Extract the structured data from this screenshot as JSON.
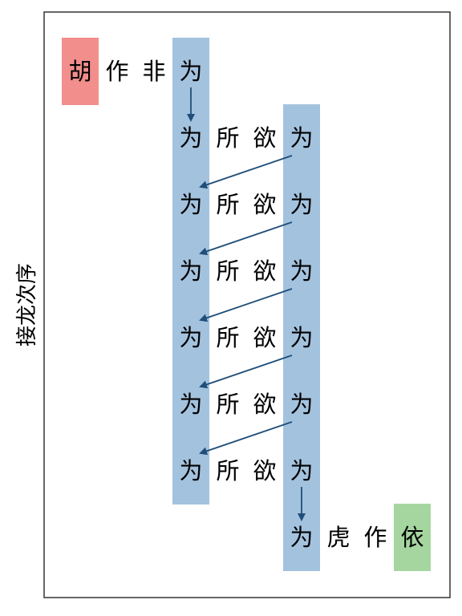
{
  "side_label": "接龙次序",
  "colors": {
    "start": "#f28e8c",
    "end": "#a6d6a0",
    "band": "#a3c2de",
    "arrow": "#1f4e79",
    "border": "#333333"
  },
  "rows": [
    [
      "胡",
      "作",
      "非",
      "为"
    ],
    [
      "为",
      "所",
      "欲",
      "为"
    ],
    [
      "为",
      "所",
      "欲",
      "为"
    ],
    [
      "为",
      "所",
      "欲",
      "为"
    ],
    [
      "为",
      "所",
      "欲",
      "为"
    ],
    [
      "为",
      "所",
      "欲",
      "为"
    ],
    [
      "为",
      "所",
      "欲",
      "为"
    ],
    [
      "为",
      "虎",
      "作",
      "依"
    ]
  ]
}
